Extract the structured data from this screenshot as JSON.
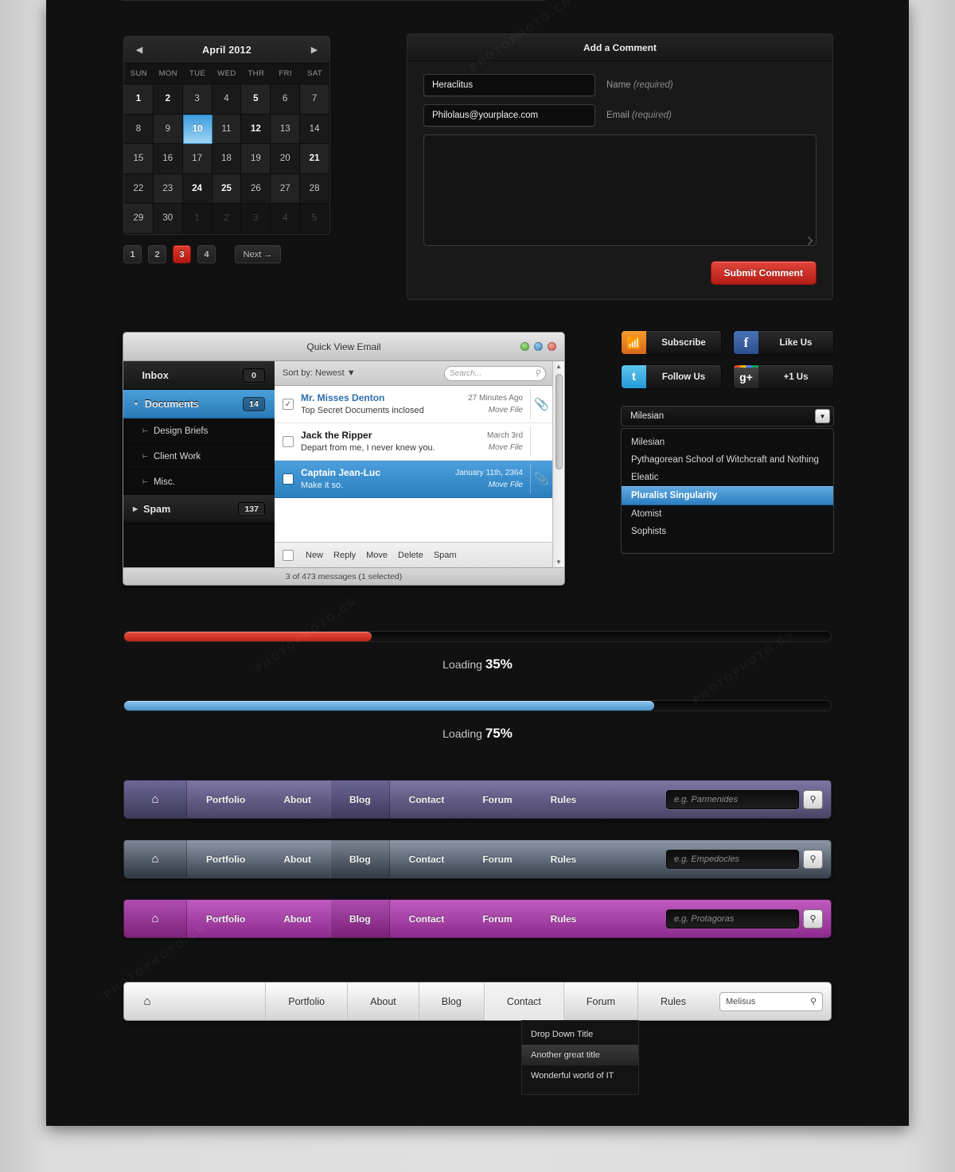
{
  "calendar": {
    "title": "April 2012",
    "prev_icon": "left-arrow-icon",
    "next_icon": "right-arrow-icon",
    "dow": [
      "SUN",
      "MON",
      "TUE",
      "WED",
      "THR",
      "FRI",
      "SAT"
    ],
    "weeks": [
      [
        {
          "d": "1",
          "s": "bold"
        },
        {
          "d": "2",
          "s": "bold"
        },
        {
          "d": "3",
          "s": ""
        },
        {
          "d": "4",
          "s": ""
        },
        {
          "d": "5",
          "s": "bold"
        },
        {
          "d": "6",
          "s": ""
        },
        {
          "d": "7",
          "s": ""
        }
      ],
      [
        {
          "d": "8",
          "s": ""
        },
        {
          "d": "9",
          "s": ""
        },
        {
          "d": "10",
          "s": "sel"
        },
        {
          "d": "11",
          "s": ""
        },
        {
          "d": "12",
          "s": "bold"
        },
        {
          "d": "13",
          "s": ""
        },
        {
          "d": "14",
          "s": ""
        }
      ],
      [
        {
          "d": "15",
          "s": ""
        },
        {
          "d": "16",
          "s": ""
        },
        {
          "d": "17",
          "s": ""
        },
        {
          "d": "18",
          "s": ""
        },
        {
          "d": "19",
          "s": ""
        },
        {
          "d": "20",
          "s": ""
        },
        {
          "d": "21",
          "s": "bold"
        }
      ],
      [
        {
          "d": "22",
          "s": ""
        },
        {
          "d": "23",
          "s": ""
        },
        {
          "d": "24",
          "s": "bold"
        },
        {
          "d": "25",
          "s": "bold"
        },
        {
          "d": "26",
          "s": ""
        },
        {
          "d": "27",
          "s": ""
        },
        {
          "d": "28",
          "s": ""
        }
      ],
      [
        {
          "d": "29",
          "s": ""
        },
        {
          "d": "30",
          "s": ""
        },
        {
          "d": "1",
          "s": "muted"
        },
        {
          "d": "2",
          "s": "muted"
        },
        {
          "d": "3",
          "s": "muted"
        },
        {
          "d": "4",
          "s": "muted"
        },
        {
          "d": "5",
          "s": "muted"
        }
      ]
    ],
    "selected_day": "10"
  },
  "pagination": {
    "pages": [
      "1",
      "2",
      "3",
      "4"
    ],
    "active": "3",
    "next_label": "Next →"
  },
  "comment_form": {
    "title": "Add a Comment",
    "name_value": "Heraclitus",
    "name_label": "Name",
    "name_required": "(required)",
    "email_value": "Philolaus@yourplace.com",
    "email_label": "Email",
    "email_required": "(required)",
    "message_value": "",
    "submit_label": "Submit Comment",
    "submit_color": "#c6281f"
  },
  "email_window": {
    "title": "Quick View Email",
    "folders": [
      {
        "label": "Inbox",
        "badge": "0",
        "type": "top",
        "selected": false,
        "icon": ""
      },
      {
        "label": "Documents",
        "badge": "14",
        "type": "top",
        "selected": true,
        "icon": "triangle-down-icon"
      },
      {
        "label": "Design Briefs",
        "badge": "",
        "type": "sub",
        "selected": false,
        "icon": "branch-icon"
      },
      {
        "label": "Client Work",
        "badge": "",
        "type": "sub",
        "selected": false,
        "icon": "branch-icon"
      },
      {
        "label": "Misc.",
        "badge": "",
        "type": "sub",
        "selected": false,
        "icon": "branch-icon"
      },
      {
        "label": "Spam",
        "badge": "137",
        "type": "top",
        "selected": false,
        "icon": "triangle-right-icon"
      }
    ],
    "sort_label": "Sort by: Newest",
    "search_placeholder": "Search...",
    "messages": [
      {
        "from": "Mr. Misses Denton",
        "subject": "Top Secret Documents inclosed",
        "date": "27 Minutes Ago",
        "action": "Move File",
        "checked": true,
        "selected": false,
        "attachment": true,
        "from_style": "link"
      },
      {
        "from": "Jack the Ripper",
        "subject": "Depart from me, I never knew you.",
        "date": "March 3rd",
        "action": "Move File",
        "checked": false,
        "selected": false,
        "attachment": false,
        "from_style": "dark"
      },
      {
        "from": "Captain Jean-Luc",
        "subject": "Make it so.",
        "date": "January 11th, 2364",
        "action": "Move File",
        "checked": false,
        "selected": true,
        "attachment": true,
        "from_style": "dark"
      }
    ],
    "tools": [
      "New",
      "Reply",
      "Move",
      "Delete",
      "Spam"
    ],
    "status": "3 of 473 messages (1 selected)",
    "window_buttons": [
      "green-button",
      "blue-button",
      "red-button"
    ]
  },
  "social": {
    "buttons": [
      {
        "label": "Subscribe",
        "icon": "rss-icon",
        "glyph": "",
        "cls": "rss"
      },
      {
        "label": "Like Us",
        "icon": "facebook-icon",
        "glyph": "f",
        "cls": "fb"
      },
      {
        "label": "Follow Us",
        "icon": "twitter-icon",
        "glyph": "t",
        "cls": "tw"
      },
      {
        "label": "+1 Us",
        "icon": "google-plus-icon",
        "glyph": "g+",
        "cls": "gp"
      }
    ]
  },
  "select": {
    "value": "Milesian",
    "arrow_icon": "chevron-down-icon",
    "options": [
      {
        "label": "Milesian",
        "selected": false
      },
      {
        "label": "Pythagorean School of Witchcraft and Nothing",
        "selected": false
      },
      {
        "label": "Eleatic",
        "selected": false
      },
      {
        "label": "Pluralist Singularity",
        "selected": true
      },
      {
        "label": "Atomist",
        "selected": false
      },
      {
        "label": "Sophists",
        "selected": false
      }
    ]
  },
  "progress": [
    {
      "prefix": "Loading",
      "percent": "35%",
      "value": 35,
      "color": "#cf3124",
      "cls": "red"
    },
    {
      "prefix": "Loading",
      "percent": "75%",
      "value": 75,
      "color": "#5ba4d8",
      "cls": "blue"
    }
  ],
  "navbars": [
    {
      "id": "nav1",
      "theme": "purple",
      "accent": "#6a6494",
      "home_icon": "home-icon",
      "items": [
        {
          "label": "Portfolio",
          "active": false
        },
        {
          "label": "About",
          "active": false
        },
        {
          "label": "Blog",
          "active": true
        },
        {
          "label": "Contact",
          "active": false
        },
        {
          "label": "Forum",
          "active": false
        },
        {
          "label": "Rules",
          "active": false
        }
      ],
      "search_placeholder": "e.g. Parmenides",
      "search_icon": "search-icon"
    },
    {
      "id": "nav2",
      "theme": "slate",
      "accent": "#7b8492",
      "home_icon": "home-icon",
      "items": [
        {
          "label": "Portfolio",
          "active": false
        },
        {
          "label": "About",
          "active": false
        },
        {
          "label": "Blog",
          "active": true
        },
        {
          "label": "Contact",
          "active": false
        },
        {
          "label": "Forum",
          "active": false
        },
        {
          "label": "Rules",
          "active": false
        }
      ],
      "search_placeholder": "e.g. Empedocles",
      "search_icon": "search-icon"
    },
    {
      "id": "nav3",
      "theme": "magenta",
      "accent": "#ae4cae",
      "home_icon": "home-icon",
      "items": [
        {
          "label": "Portfolio",
          "active": false
        },
        {
          "label": "About",
          "active": false
        },
        {
          "label": "Blog",
          "active": true
        },
        {
          "label": "Contact",
          "active": false
        },
        {
          "label": "Forum",
          "active": false
        },
        {
          "label": "Rules",
          "active": false
        }
      ],
      "search_placeholder": "e.g. Protagoras",
      "search_icon": "search-icon"
    }
  ],
  "light_nav": {
    "home_icon": "home-icon",
    "items": [
      {
        "label": "Portfolio",
        "active": false
      },
      {
        "label": "About",
        "active": false
      },
      {
        "label": "Blog",
        "active": false
      },
      {
        "label": "Contact",
        "active": true
      },
      {
        "label": "Forum",
        "active": false
      },
      {
        "label": "Rules",
        "active": false
      }
    ],
    "search_value": "Melisus",
    "search_icon": "search-icon",
    "dropdown": [
      {
        "label": "Drop Down Title",
        "hover": false
      },
      {
        "label": "Another great title",
        "hover": true
      },
      {
        "label": "Wonderful world of IT",
        "hover": false
      }
    ]
  }
}
